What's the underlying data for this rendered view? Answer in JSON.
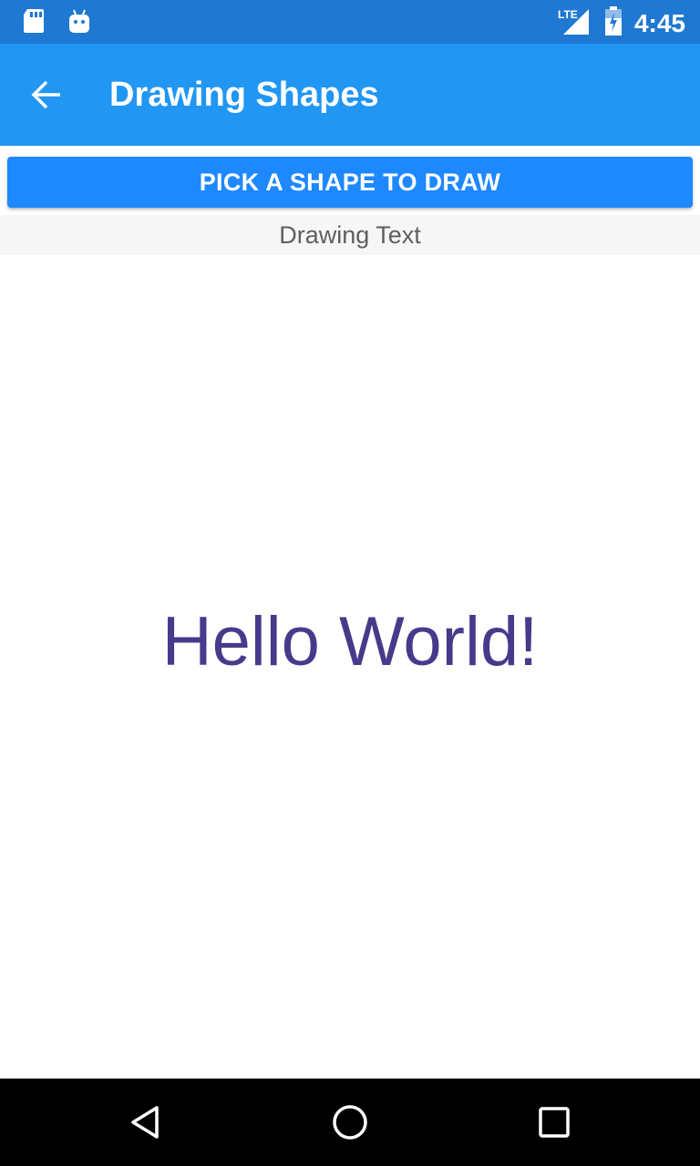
{
  "status_bar": {
    "time": "4:45",
    "network": "LTE",
    "icons": [
      "sd-card-icon",
      "android-icon",
      "signal-icon",
      "battery-icon"
    ],
    "background": "#1f78d1"
  },
  "app_bar": {
    "title": "Drawing Shapes",
    "back_icon": "arrow-left-icon",
    "background": "#2196f3"
  },
  "main": {
    "pick_button_label": "PICK A SHAPE TO DRAW",
    "current_mode": "Drawing Text",
    "canvas_text": "Hello World!",
    "canvas_text_color": "#463b8a",
    "button_color": "#1e88ff"
  },
  "nav_bar": {
    "buttons": [
      "back-icon",
      "home-icon",
      "recents-icon"
    ]
  }
}
